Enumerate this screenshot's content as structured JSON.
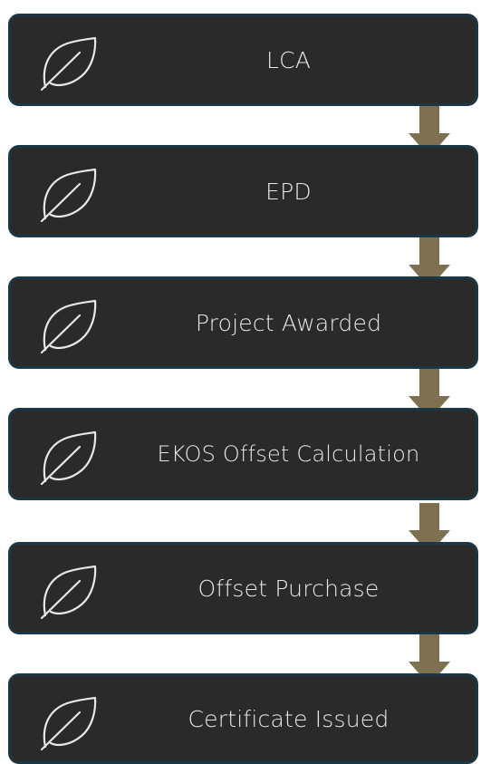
{
  "colors": {
    "box_fill": "#2a2a2a",
    "box_border": "#1b3645",
    "arrow": "#7d7152",
    "text": "#e8e8e8"
  },
  "icon": "leaf-icon",
  "steps": [
    {
      "label": "LCA"
    },
    {
      "label": "EPD"
    },
    {
      "label": "Project Awarded"
    },
    {
      "label": "EKOS Offset Calculation"
    },
    {
      "label": "Offset Purchase"
    },
    {
      "label": "Certificate Issued"
    }
  ]
}
